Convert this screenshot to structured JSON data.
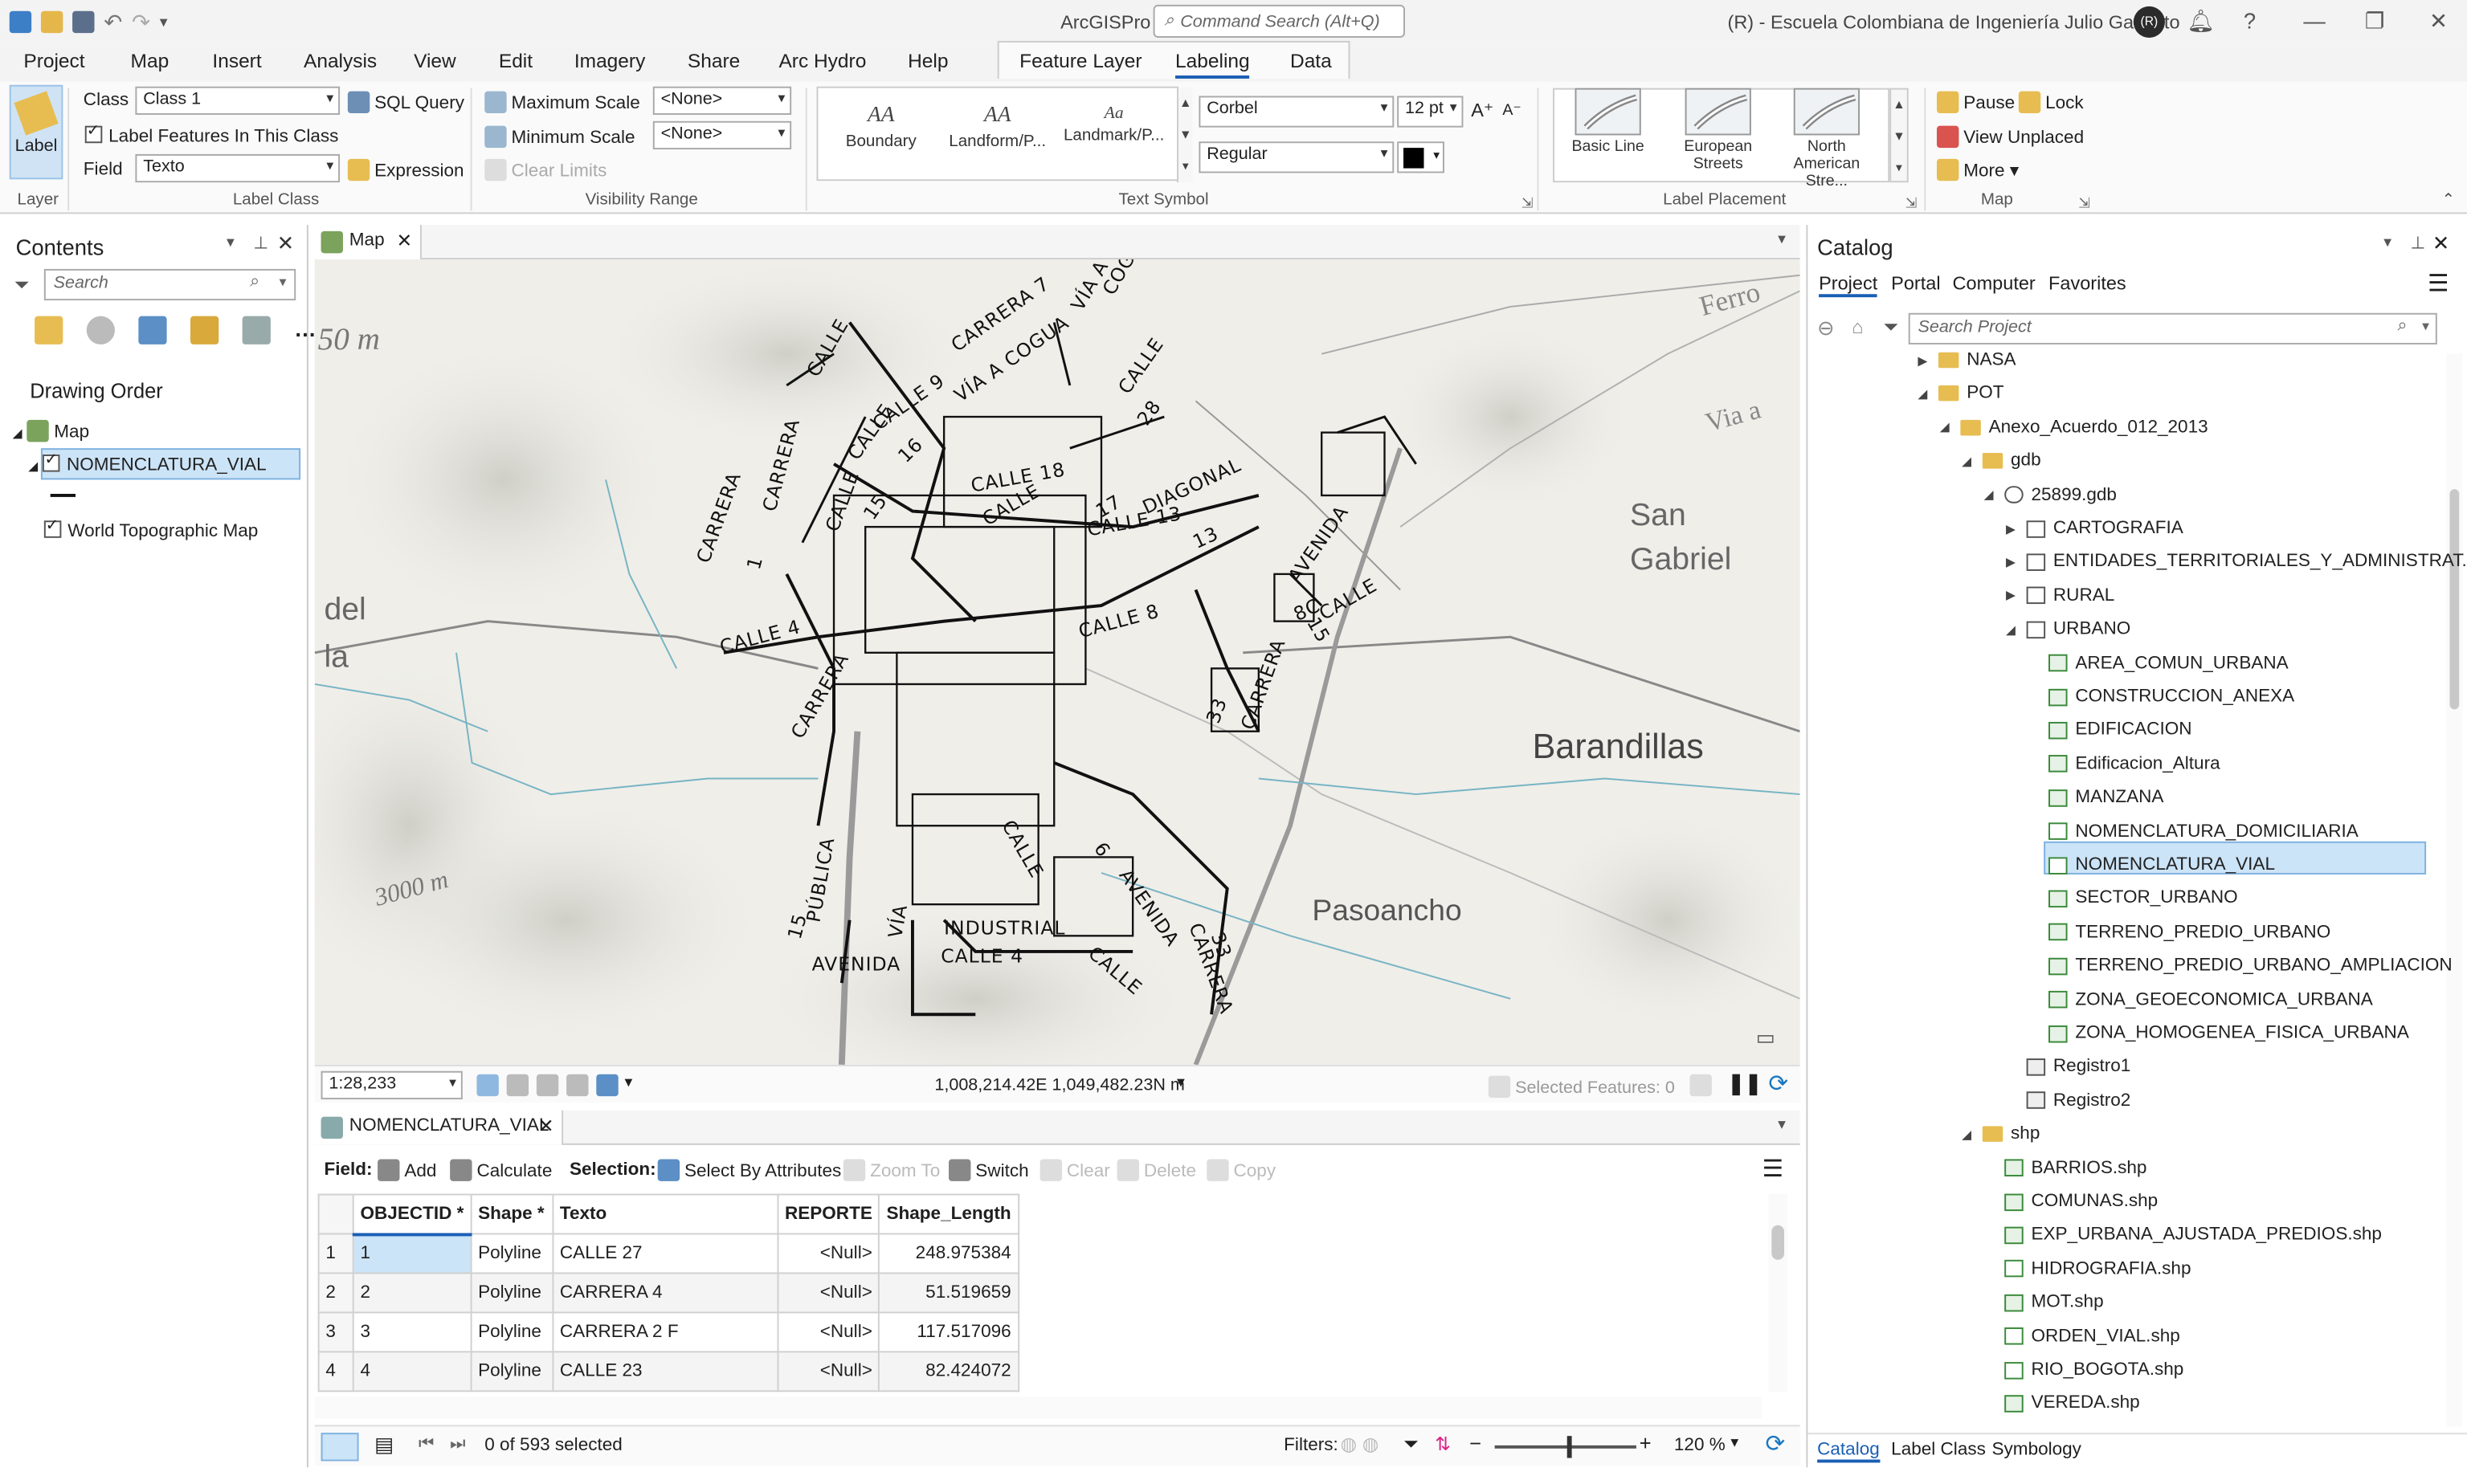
{
  "title_bar": {
    "app_name": "ArcGISPro",
    "command_search_placeholder": "Command Search (Alt+Q)",
    "org": "(R) - Escuela Colombiana de Ingeniería Julio Garavito",
    "avatar_initials": "(R)"
  },
  "ribbon_tabs": [
    "Project",
    "Map",
    "Insert",
    "Analysis",
    "View",
    "Edit",
    "Imagery",
    "Share",
    "Arc Hydro",
    "Help"
  ],
  "context_tabs": [
    "Feature Layer",
    "Labeling",
    "Data"
  ],
  "ribbon": {
    "layer": {
      "button": "Label",
      "group": "Layer"
    },
    "label_class": {
      "class_label": "Class",
      "class_value": "Class 1",
      "sql_query": "SQL Query",
      "label_features": "Label Features In This Class",
      "field_label": "Field",
      "field_value": "Texto",
      "expression": "Expression",
      "group": "Label Class"
    },
    "visibility": {
      "max_scale": "Maximum Scale",
      "max_value": "<None>",
      "min_scale": "Minimum Scale",
      "min_value": "<None>",
      "clear_limits": "Clear Limits",
      "group": "Visibility Range"
    },
    "text_symbol": {
      "gallery": [
        {
          "sample": "AA",
          "label": "Boundary"
        },
        {
          "sample": "AA",
          "label": "Landform/P..."
        },
        {
          "sample": "Aa",
          "label": "Landmark/P..."
        }
      ],
      "font": "Corbel",
      "size": "12 pt",
      "style": "Regular",
      "group": "Text Symbol"
    },
    "label_placement": {
      "items": [
        "Basic Line",
        "European Streets",
        "North American Stre..."
      ],
      "group": "Label Placement"
    },
    "map": {
      "pause": "Pause",
      "lock": "Lock",
      "view_unplaced": "View Unplaced",
      "more": "More",
      "group": "Map"
    }
  },
  "contents": {
    "title": "Contents",
    "search_placeholder": "Search",
    "drawing_order": "Drawing Order",
    "map_label": "Map",
    "layers": [
      "NOMENCLATURA_VIAL",
      "World Topographic Map"
    ]
  },
  "map": {
    "tab": "Map",
    "scale": "1:28,233",
    "coords": "1,008,214.42E 1,049,482.23N m",
    "selected_features": "Selected Features: 0",
    "basemap_labels": [
      "50 m",
      "Ferro",
      "Via a",
      "San",
      "Gabriel",
      "del",
      "la",
      "Barandillas",
      "Pasoancho",
      "3000 m"
    ],
    "street_labels": [
      "CALLE",
      "CARRERA 7",
      "VÍA A",
      "COGUA",
      "CALLE 9",
      "CARRERA",
      "VÍA A COGUA",
      "CALLE",
      "28",
      "CALLE",
      "16",
      "CALLE 18",
      "CALLE",
      "17",
      "15",
      "CARRERA",
      "1",
      "CALLE",
      "CALLE 13",
      "DIAGONAL",
      "13",
      "CALLE 8",
      "CALLE 4",
      "CARRERA",
      "33",
      "CARRERA",
      "15",
      "VÍA",
      "PÚBLICA",
      "AVENIDA",
      "INDUSTRIAL",
      "CALLE 4",
      "CALLE",
      "6",
      "AVENIDA",
      "CALLE",
      "CARRERA",
      "33",
      "CALLE",
      "8C",
      "AVENIDA",
      "15"
    ]
  },
  "table": {
    "tab": "NOMENCLATURA_VIAL",
    "field_label": "Field:",
    "add": "Add",
    "calculate": "Calculate",
    "selection_label": "Selection:",
    "select_by_attributes": "Select By Attributes",
    "zoom_to": "Zoom To",
    "switch": "Switch",
    "clear": "Clear",
    "delete": "Delete",
    "copy": "Copy",
    "columns": [
      "OBJECTID *",
      "Shape *",
      "Texto",
      "REPORTE",
      "Shape_Length"
    ],
    "rows": [
      [
        "1",
        "1",
        "Polyline",
        "CALLE 27",
        "<Null>",
        "248.975384"
      ],
      [
        "2",
        "2",
        "Polyline",
        "CARRERA 4",
        "<Null>",
        "51.519659"
      ],
      [
        "3",
        "3",
        "Polyline",
        "CARRERA 2 F",
        "<Null>",
        "117.517096"
      ],
      [
        "4",
        "4",
        "Polyline",
        "CALLE 23",
        "<Null>",
        "82.424072"
      ]
    ],
    "selected_count": "0 of 593 selected",
    "filters": "Filters:",
    "zoom": "120 %"
  },
  "catalog": {
    "title": "Catalog",
    "tabs": [
      "Project",
      "Portal",
      "Computer",
      "Favorites"
    ],
    "search_placeholder": "Search Project",
    "items": [
      {
        "label": "NASA",
        "type": "folder",
        "indent": 1,
        "arrow": "▶"
      },
      {
        "label": "POT",
        "type": "folder",
        "indent": 1,
        "arrow": "◢"
      },
      {
        "label": "Anexo_Acuerdo_012_2013",
        "type": "folder",
        "indent": 2,
        "arrow": "◢"
      },
      {
        "label": "gdb",
        "type": "folder",
        "indent": 3,
        "arrow": "◢"
      },
      {
        "label": "25899.gdb",
        "type": "gdb",
        "indent": 4,
        "arrow": "◢"
      },
      {
        "label": "CARTOGRAFIA",
        "type": "dataset",
        "indent": 5,
        "arrow": "▶"
      },
      {
        "label": "ENTIDADES_TERRITORIALES_Y_ADMINISTRAT...",
        "type": "dataset",
        "indent": 5,
        "arrow": "▶"
      },
      {
        "label": "RURAL",
        "type": "dataset",
        "indent": 5,
        "arrow": "▶"
      },
      {
        "label": "URBANO",
        "type": "dataset",
        "indent": 5,
        "arrow": "◢"
      },
      {
        "label": "AREA_COMUN_URBANA",
        "type": "fc",
        "indent": 6,
        "arrow": ""
      },
      {
        "label": "CONSTRUCCION_ANEXA",
        "type": "fc",
        "indent": 6,
        "arrow": ""
      },
      {
        "label": "EDIFICACION",
        "type": "fc",
        "indent": 6,
        "arrow": ""
      },
      {
        "label": "Edificacion_Altura",
        "type": "fc",
        "indent": 6,
        "arrow": ""
      },
      {
        "label": "MANZANA",
        "type": "fc",
        "indent": 6,
        "arrow": ""
      },
      {
        "label": "NOMENCLATURA_DOMICILIARIA",
        "type": "fcl",
        "indent": 6,
        "arrow": ""
      },
      {
        "label": "NOMENCLATURA_VIAL",
        "type": "fcl",
        "indent": 6,
        "arrow": "",
        "selected": true
      },
      {
        "label": "SECTOR_URBANO",
        "type": "fc",
        "indent": 6,
        "arrow": ""
      },
      {
        "label": "TERRENO_PREDIO_URBANO",
        "type": "fc",
        "indent": 6,
        "arrow": ""
      },
      {
        "label": "TERRENO_PREDIO_URBANO_AMPLIACION",
        "type": "fc",
        "indent": 6,
        "arrow": ""
      },
      {
        "label": "ZONA_GEOECONOMICA_URBANA",
        "type": "fc",
        "indent": 6,
        "arrow": ""
      },
      {
        "label": "ZONA_HOMOGENEA_FISICA_URBANA",
        "type": "fc",
        "indent": 6,
        "arrow": ""
      },
      {
        "label": "Registro1",
        "type": "table",
        "indent": 5,
        "arrow": ""
      },
      {
        "label": "Registro2",
        "type": "table",
        "indent": 5,
        "arrow": ""
      },
      {
        "label": "shp",
        "type": "folder",
        "indent": 3,
        "arrow": "◢"
      },
      {
        "label": "BARRIOS.shp",
        "type": "fc",
        "indent": 4,
        "arrow": ""
      },
      {
        "label": "COMUNAS.shp",
        "type": "fc",
        "indent": 4,
        "arrow": ""
      },
      {
        "label": "EXP_URBANA_AJUSTADA_PREDIOS.shp",
        "type": "fc",
        "indent": 4,
        "arrow": ""
      },
      {
        "label": "HIDROGRAFIA.shp",
        "type": "fcl",
        "indent": 4,
        "arrow": ""
      },
      {
        "label": "MOT.shp",
        "type": "fc",
        "indent": 4,
        "arrow": ""
      },
      {
        "label": "ORDEN_VIAL.shp",
        "type": "fcl",
        "indent": 4,
        "arrow": ""
      },
      {
        "label": "RIO_BOGOTA.shp",
        "type": "fcl",
        "indent": 4,
        "arrow": ""
      },
      {
        "label": "VEREDA.shp",
        "type": "fc",
        "indent": 4,
        "arrow": ""
      }
    ],
    "bottom_tabs": [
      "Catalog",
      "Label Class",
      "Symbology"
    ]
  },
  "colors": {
    "accent": "#1a5fb4",
    "selected_bg": "#cce4f7",
    "folder": "#e7bd52"
  }
}
